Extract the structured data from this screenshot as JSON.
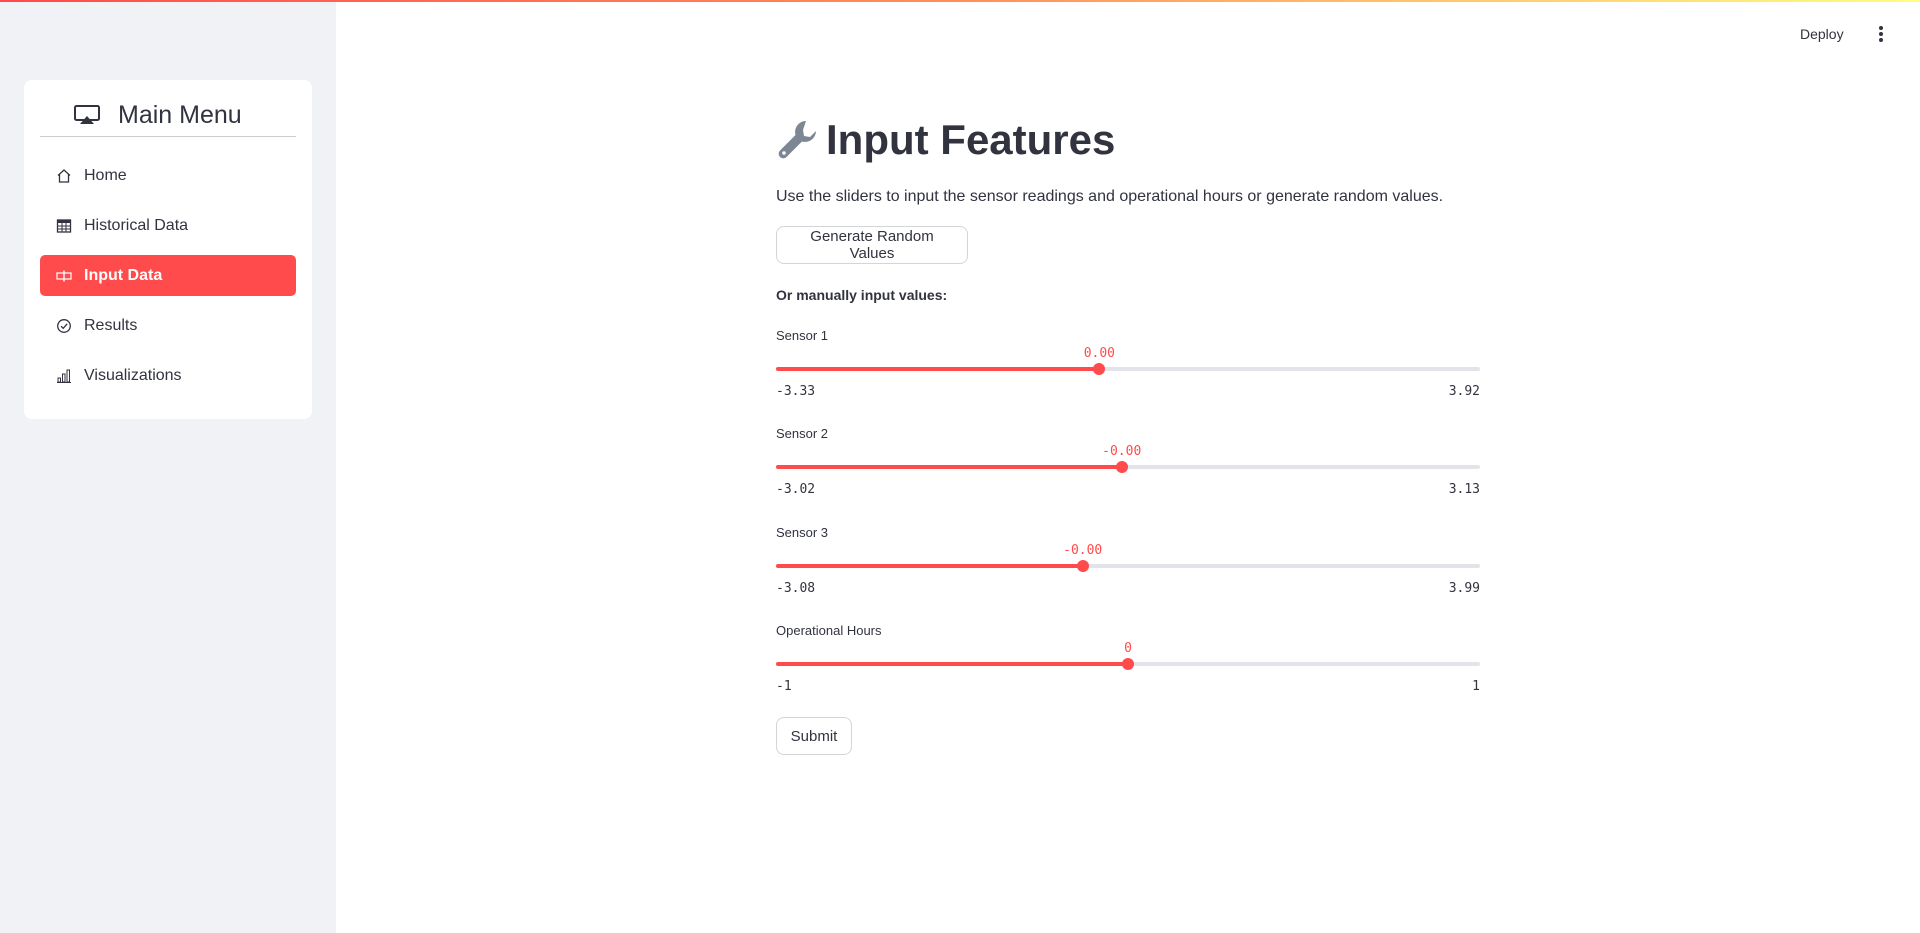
{
  "header": {
    "deploy_label": "Deploy",
    "more_icon": "more-vertical-icon"
  },
  "sidebar": {
    "menu_title": "Main Menu",
    "menu_icon": "cast-icon",
    "items": [
      {
        "label": "Home",
        "icon": "house-icon",
        "active": false
      },
      {
        "label": "Historical Data",
        "icon": "table-icon",
        "active": false
      },
      {
        "label": "Input Data",
        "icon": "input-cursor-icon",
        "active": true
      },
      {
        "label": "Results",
        "icon": "check-circle-icon",
        "active": false
      },
      {
        "label": "Visualizations",
        "icon": "bar-chart-icon",
        "active": false
      }
    ],
    "accent_color": "#ff4b4b"
  },
  "main": {
    "title": "Input Features",
    "title_icon": "wrench-icon",
    "description": "Use the sliders to input the sensor readings and operational hours or generate random values.",
    "random_button": "Generate Random Values",
    "manual_label": "Or manually input values:",
    "submit_button": "Submit",
    "sliders": [
      {
        "label": "Sensor 1",
        "value": 0.0,
        "value_text": "0.00",
        "min": -3.33,
        "max": 3.92,
        "min_text": "-3.33",
        "max_text": "3.92"
      },
      {
        "label": "Sensor 2",
        "value": 0.0,
        "value_text": "-0.00",
        "min": -3.02,
        "max": 3.13,
        "min_text": "-3.02",
        "max_text": "3.13"
      },
      {
        "label": "Sensor 3",
        "value": 0.0,
        "value_text": "-0.00",
        "min": -3.08,
        "max": 3.99,
        "min_text": "-3.08",
        "max_text": "3.99"
      },
      {
        "label": "Operational Hours",
        "value": 0,
        "value_text": "0",
        "min": -1,
        "max": 1,
        "min_text": "-1",
        "max_text": "1"
      }
    ]
  }
}
